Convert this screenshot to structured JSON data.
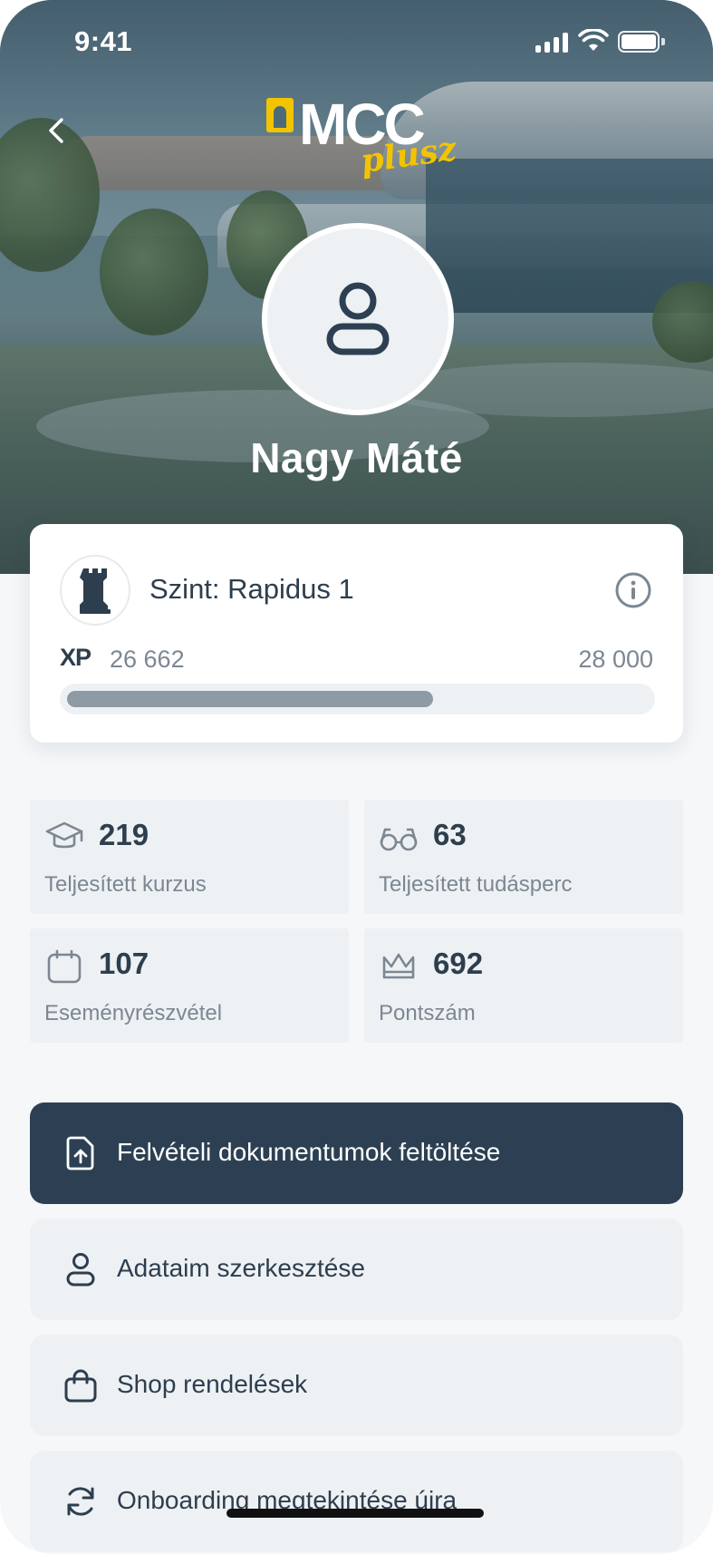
{
  "status_bar": {
    "time": "9:41"
  },
  "header": {
    "logo_text": "MCC",
    "logo_sub": "plusz"
  },
  "profile": {
    "name": "Nagy Máté"
  },
  "level": {
    "title": "Szint: Rapidus 1",
    "xp_label": "XP",
    "xp_current": "26 662",
    "xp_max": "28 000",
    "progress_fraction": 0.63
  },
  "stats": [
    {
      "icon": "graduation-cap-icon",
      "value": "219",
      "label": "Teljesített kurzus"
    },
    {
      "icon": "glasses-icon",
      "value": "63",
      "label": "Teljesített tudásperc"
    },
    {
      "icon": "calendar-icon",
      "value": "107",
      "label": "Eseményrészvétel"
    },
    {
      "icon": "crown-icon",
      "value": "692",
      "label": "Pontszám"
    }
  ],
  "actions": [
    {
      "icon": "file-upload-icon",
      "label": "Felvételi dokumentumok feltöltése",
      "primary": true
    },
    {
      "icon": "user-icon",
      "label": "Adataim szerkesztése"
    },
    {
      "icon": "shopping-bag-icon",
      "label": "Shop rendelések"
    },
    {
      "icon": "refresh-icon",
      "label": "Onboarding megtekintése újra"
    }
  ],
  "colors": {
    "primary_dark": "#2d4053",
    "card_bg": "#eef1f4",
    "text_dark": "#2d3e4e",
    "text_muted": "#7c8792",
    "logo_yellow": "#f2c400"
  }
}
